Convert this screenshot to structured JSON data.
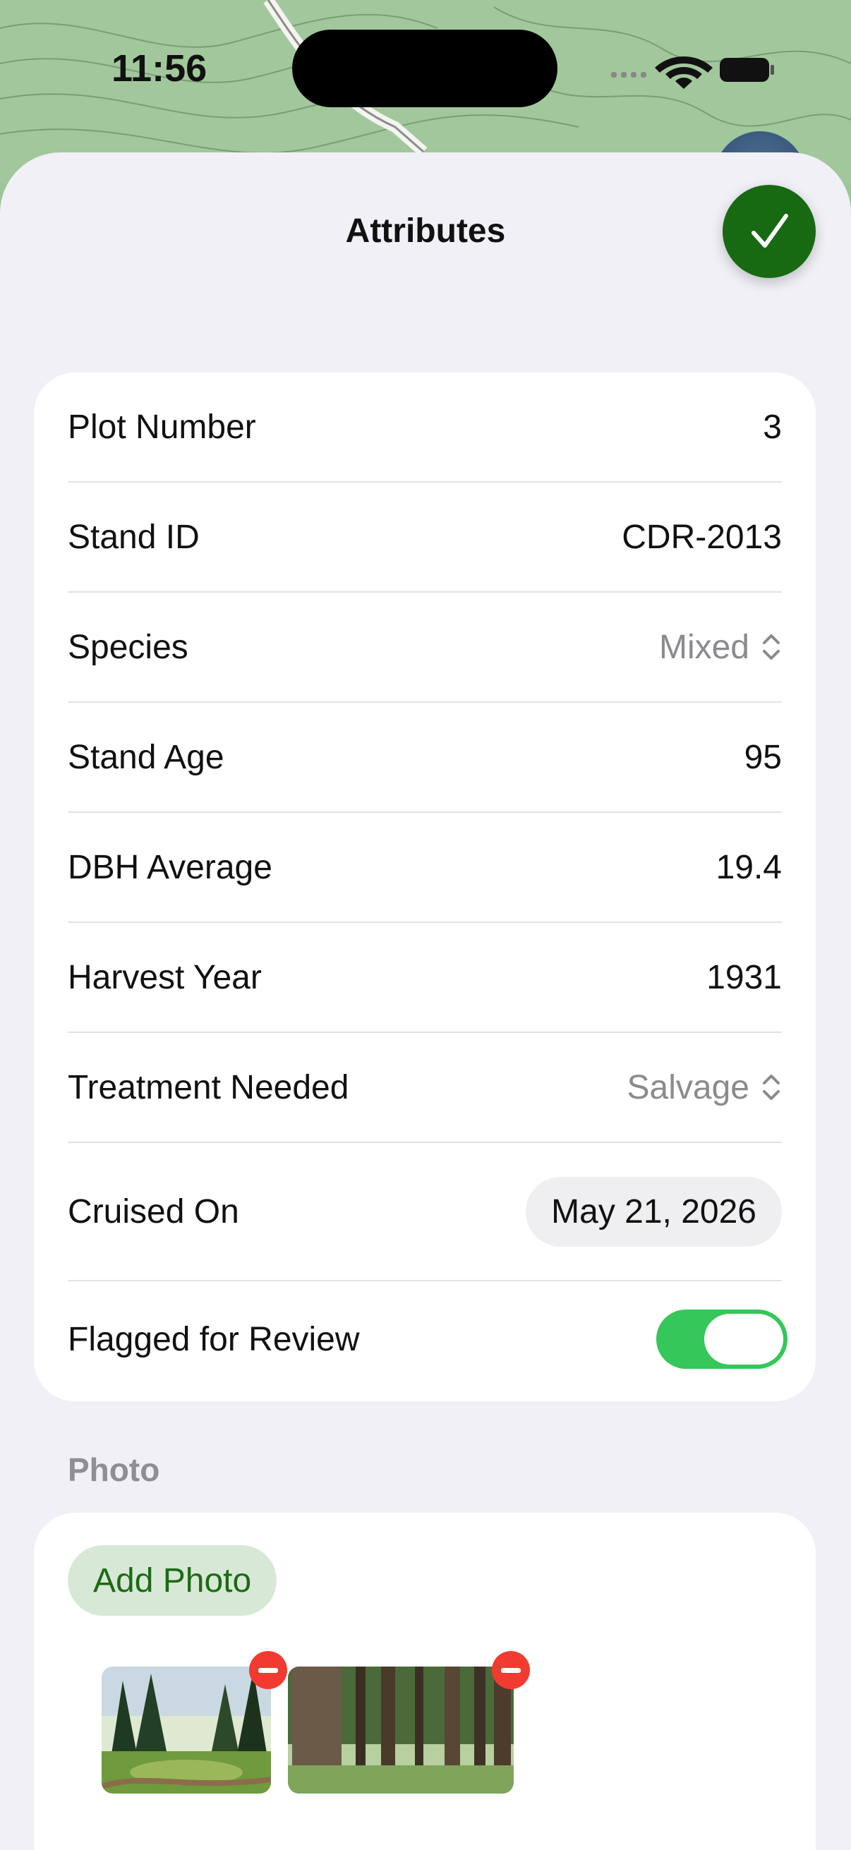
{
  "status_bar": {
    "time": "11:56"
  },
  "sheet": {
    "title": "Attributes"
  },
  "attributes": [
    {
      "label": "Plot Number",
      "value": "3",
      "kind": "text"
    },
    {
      "label": "Stand ID",
      "value": "CDR-2013",
      "kind": "text"
    },
    {
      "label": "Species",
      "value": "Mixed",
      "kind": "picker"
    },
    {
      "label": "Stand Age",
      "value": "95",
      "kind": "text"
    },
    {
      "label": "DBH Average",
      "value": "19.4",
      "kind": "text"
    },
    {
      "label": "Harvest Year",
      "value": "1931",
      "kind": "text"
    },
    {
      "label": "Treatment Needed",
      "value": "Salvage",
      "kind": "picker"
    },
    {
      "label": "Cruised On",
      "value": "May 21, 2026",
      "kind": "date"
    },
    {
      "label": "Flagged for Review",
      "value": true,
      "kind": "toggle"
    }
  ],
  "photo_section": {
    "header": "Photo",
    "add_button_label": "Add Photo",
    "photos": [
      {
        "icon": "forest-photo-thumbnail",
        "remove_icon": "minus-circle-icon"
      },
      {
        "icon": "forest-photo-thumbnail",
        "remove_icon": "minus-circle-icon"
      }
    ]
  },
  "colors": {
    "accent_green": "#176a12",
    "toggle_on": "#35c759",
    "remove_red": "#f23b30",
    "secondary_text": "#8a8a8f"
  }
}
